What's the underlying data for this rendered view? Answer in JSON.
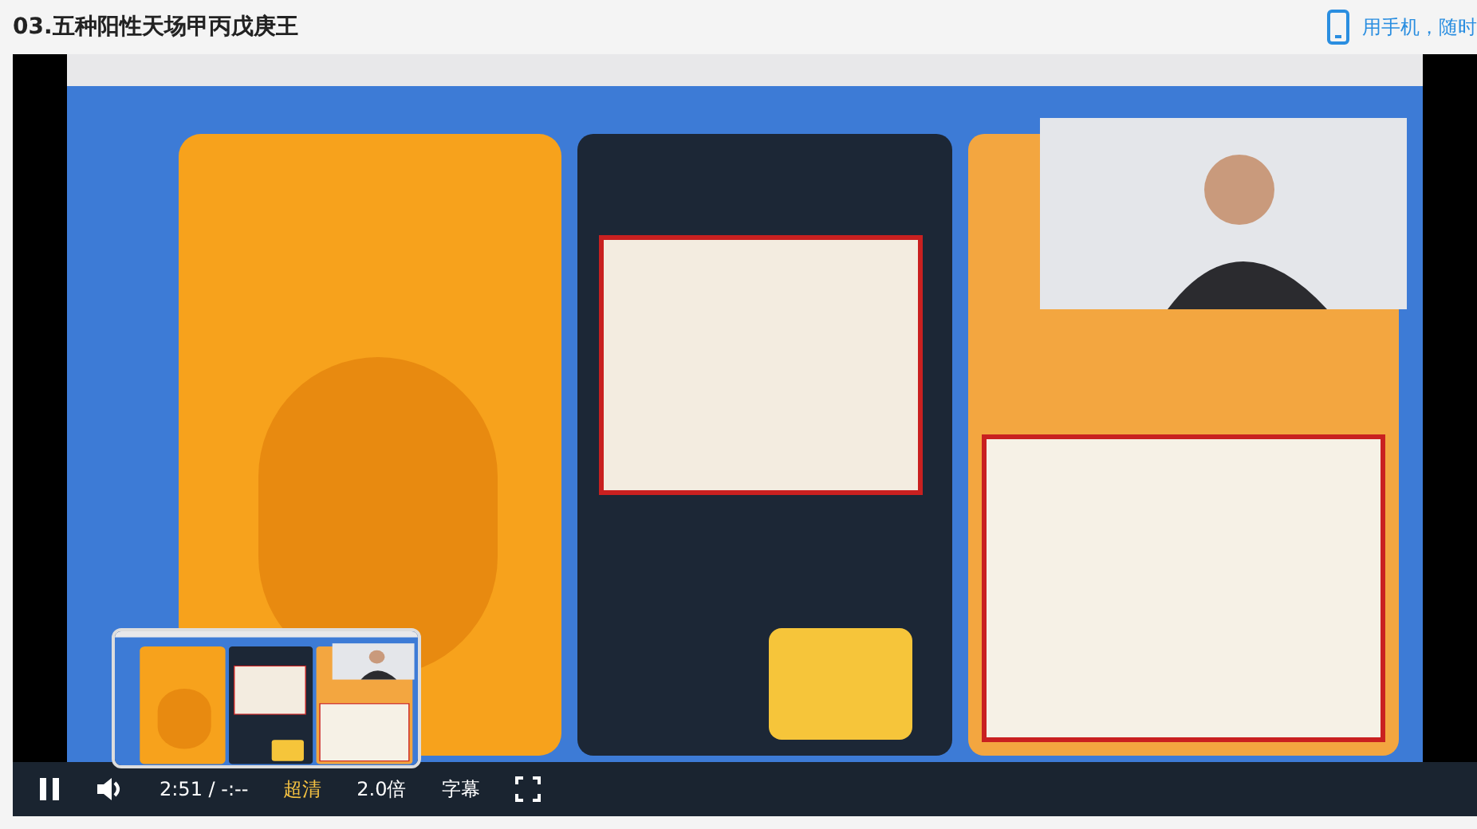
{
  "title": "03.五种阳性天场甲丙戊庚王",
  "mobile_link": "用手机，随时",
  "player": {
    "playing": true,
    "time": "2:51 / -:--",
    "quality": "超清",
    "speed": "2.0倍",
    "subtitles": "字幕"
  }
}
